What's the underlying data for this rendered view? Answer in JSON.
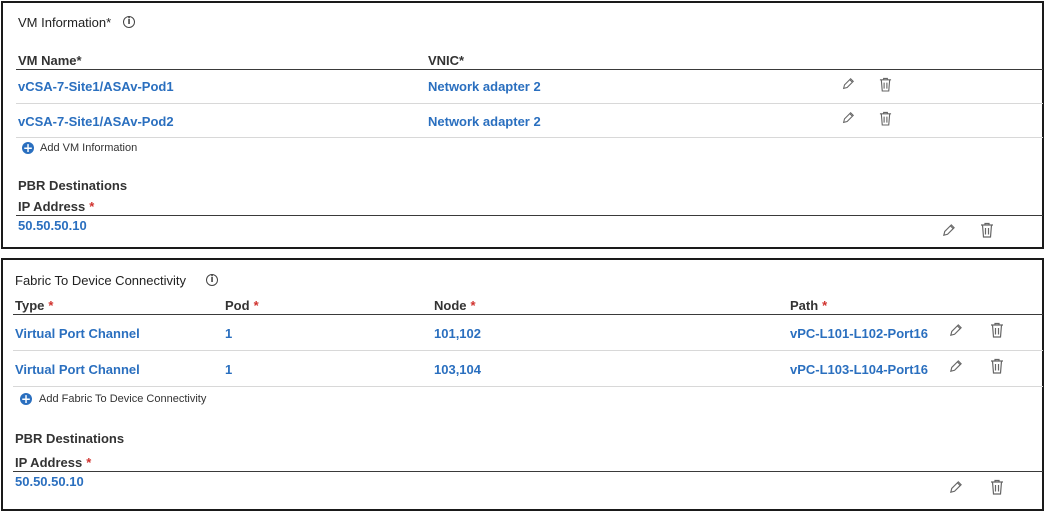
{
  "vm_panel": {
    "title": "VM Information*",
    "info_icon": "info-icon",
    "col_vm_name": "VM Name*",
    "col_vnic": "VNIC*",
    "rows": [
      {
        "vm_name": "vCSA-7-Site1/ASAv-Pod1",
        "vnic": "Network adapter 2"
      },
      {
        "vm_name": "vCSA-7-Site1/ASAv-Pod2",
        "vnic": "Network adapter 2"
      }
    ],
    "add_label": "Add VM Information",
    "pbr_title": "PBR Destinations",
    "ip_header": "IP Address",
    "ip_required": "*",
    "ip_value": "50.50.50.10"
  },
  "fabric_panel": {
    "title": "Fabric To Device Connectivity",
    "info_icon": "info-icon",
    "col_type": "Type",
    "col_pod": "Pod",
    "col_node": "Node",
    "col_path": "Path",
    "required_mark": "*",
    "rows": [
      {
        "type": "Virtual Port Channel",
        "pod": "1",
        "node": "101,102",
        "path": "vPC-L101-L102-Port16"
      },
      {
        "type": "Virtual Port Channel",
        "pod": "1",
        "node": "103,104",
        "path": "vPC-L103-L104-Port16"
      }
    ],
    "add_label": "Add Fabric To Device Connectivity",
    "pbr_title": "PBR Destinations",
    "ip_header": "IP Address",
    "ip_required": "*",
    "ip_value": "50.50.50.10"
  },
  "icons": {
    "edit": "pencil-icon",
    "delete": "trash-icon",
    "add": "plus-circle-icon",
    "info": "info-icon"
  },
  "colors": {
    "link": "#2a6fbf",
    "required": "#d0312d",
    "border": "#1a1a1a"
  }
}
